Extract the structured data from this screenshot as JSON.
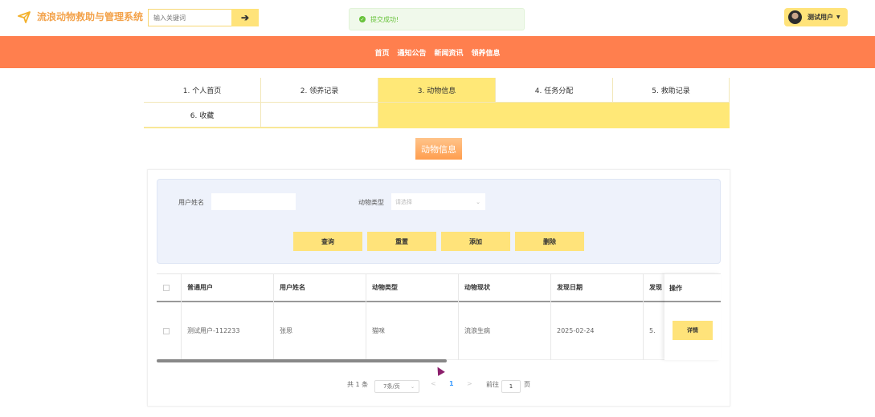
{
  "header": {
    "app_title": "流浪动物救助与管理系统",
    "search_placeholder": "输入关键词",
    "toast_message": "提交成功!",
    "user_name": "测试用户"
  },
  "nav": {
    "items": [
      "首页",
      "通知公告",
      "新闻资讯",
      "领养信息"
    ]
  },
  "tabs": [
    {
      "label": "1. 个人首页"
    },
    {
      "label": "2. 领养记录"
    },
    {
      "label": "3. 动物信息",
      "active": true
    },
    {
      "label": "4. 任务分配"
    },
    {
      "label": "5. 救助记录"
    },
    {
      "label": "6. 收藏"
    }
  ],
  "section_title": "动物信息",
  "filter": {
    "user_name_label": "用户姓名",
    "animal_type_label": "动物类型",
    "animal_type_placeholder": "请选择",
    "buttons": {
      "query": "查询",
      "reset": "重置",
      "add": "添加",
      "delete": "删除"
    }
  },
  "table": {
    "columns": [
      "普通用户",
      "用户姓名",
      "动物类型",
      "动物现状",
      "发现日期",
      "发现",
      "操作"
    ],
    "rows": [
      {
        "user": "测试用户-112233",
        "name": "张思",
        "type": "猫咪",
        "status": "流浪生病",
        "date": "2025-02-24",
        "extra": "5.",
        "action": "详情"
      }
    ]
  },
  "pagination": {
    "total": "共 1 条",
    "page_size": "7条/页",
    "prev": "<",
    "current": "1",
    "next": ">",
    "goto_prefix": "前往",
    "goto_value": "1",
    "goto_suffix": "页"
  },
  "colors": {
    "accent_orange": "#ff7f4e",
    "accent_yellow": "#ffe37a",
    "success": "#67c23a"
  }
}
